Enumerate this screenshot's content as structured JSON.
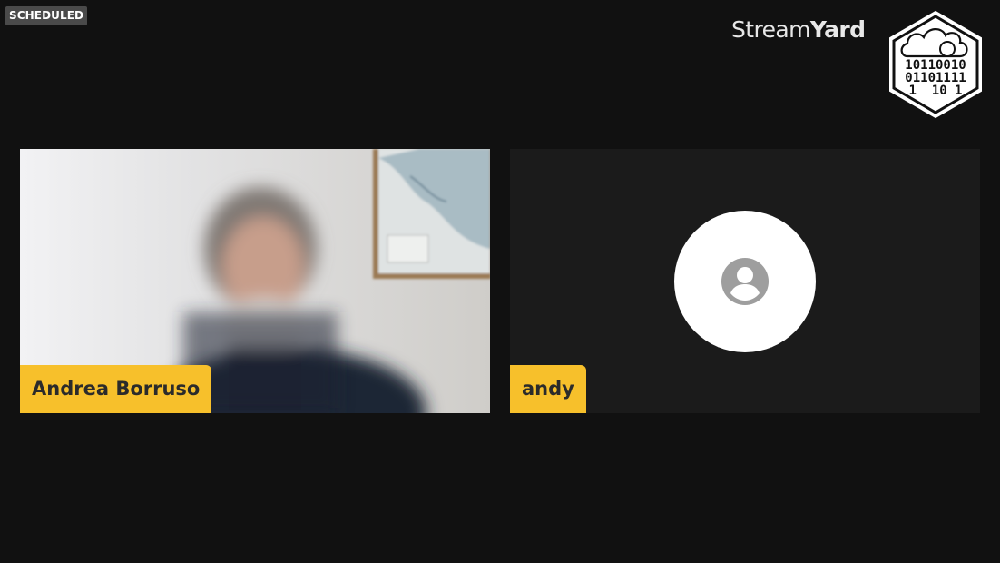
{
  "status": {
    "badge": "SCHEDULED"
  },
  "brand": {
    "name_light": "Stream",
    "name_bold": "Yard"
  },
  "channel_logo": {
    "icon": "cloud-binary-hexagon-logo",
    "rows": [
      "10110010",
      "01101111",
      "1  10 1"
    ]
  },
  "participants": [
    {
      "name": "Andrea Borruso",
      "video": "camera-feed"
    },
    {
      "name": "andy",
      "video": "off",
      "avatar_icon": "user-circle-icon"
    }
  ],
  "colors": {
    "background": "#111111",
    "name_tag": "#f7c02b",
    "tile_empty": "#1b1b1b",
    "badge": "#4a4a4a"
  }
}
